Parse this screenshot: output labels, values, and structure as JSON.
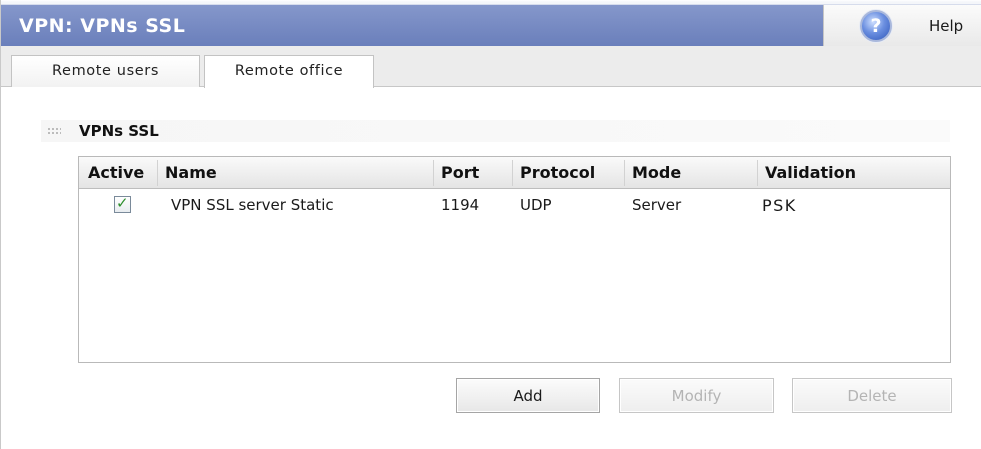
{
  "window": {
    "title": "VPN: VPNs SSL",
    "help_label": "Help",
    "help_glyph": "?"
  },
  "tabs": [
    {
      "label": "Remote users",
      "active": false
    },
    {
      "label": "Remote office",
      "active": true
    }
  ],
  "section": {
    "title": "VPNs SSL"
  },
  "table": {
    "columns": [
      "Active",
      "Name",
      "Port",
      "Protocol",
      "Mode",
      "Validation"
    ],
    "rows": [
      {
        "active": true,
        "check_glyph": "✓",
        "name": "VPN SSL server Static",
        "port": "1194",
        "protocol": "UDP",
        "mode": "Server",
        "validation": "PSK"
      }
    ]
  },
  "buttons": {
    "add": {
      "label": "Add",
      "enabled": true
    },
    "modify": {
      "label": "Modify",
      "enabled": false
    },
    "delete": {
      "label": "Delete",
      "enabled": false
    }
  },
  "colors": {
    "title_bar": "#7387c0",
    "check_mark": "#2e8f2e",
    "disabled_text": "#b4b4b4"
  }
}
